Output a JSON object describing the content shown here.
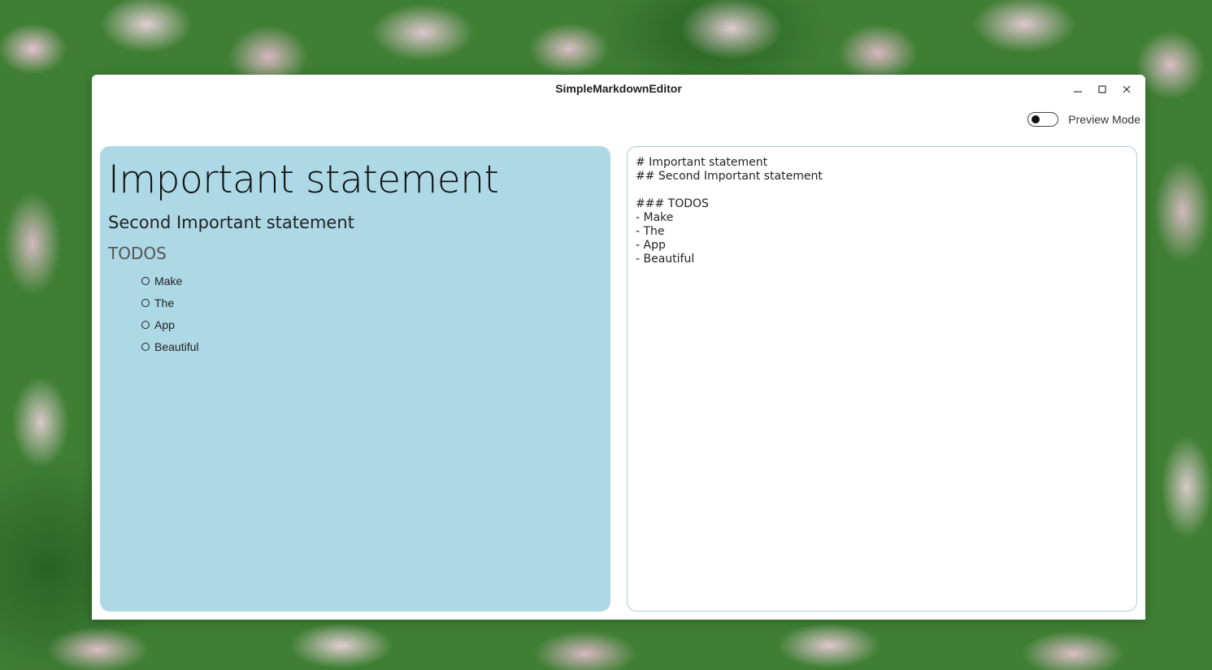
{
  "window": {
    "title": "SimpleMarkdownEditor",
    "controls": {
      "minimize": "minimize-icon",
      "maximize": "maximize-icon",
      "close": "close-icon"
    }
  },
  "toolbar": {
    "preview_toggle_label": "Preview Mode",
    "preview_toggle_on": false
  },
  "preview": {
    "h1": "Important statement",
    "h2": "Second Important statement",
    "h3": "TODOS",
    "items": [
      "Make",
      "The",
      "App",
      "Beautiful"
    ]
  },
  "editor": {
    "lines": [
      "# Important statement",
      "## Second Important statement",
      "",
      "### TODOS",
      "- Make",
      "- The",
      "- App",
      "- Beautiful"
    ]
  },
  "colors": {
    "preview_background": "#add8e6",
    "editor_border": "#a9cfd8",
    "window_background": "#ffffff"
  }
}
